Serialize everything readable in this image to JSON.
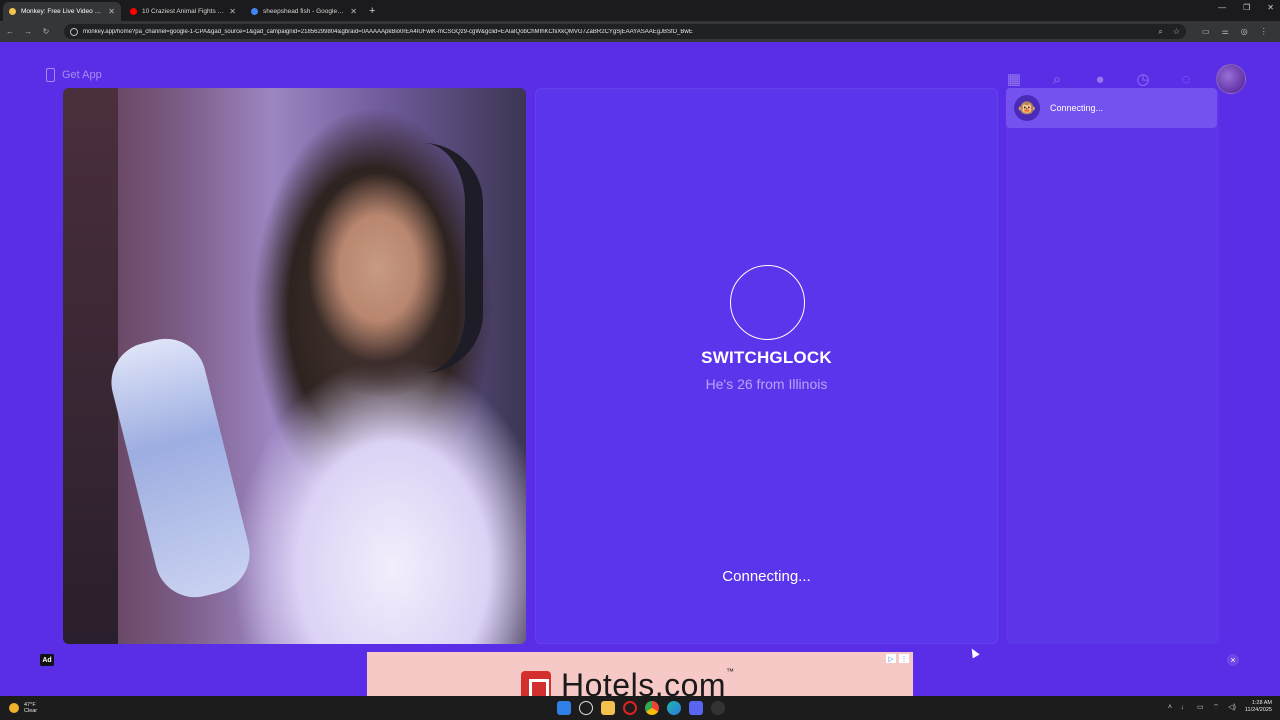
{
  "browser": {
    "tabs": [
      {
        "title": "Monkey: Free Live Video Chat",
        "active": true,
        "favicon_color": "#f5c24a"
      },
      {
        "title": "10 Craziest Animal Fights in the",
        "active": false,
        "favicon_color": "#ff0000"
      },
      {
        "title": "sheepshead fish - Google Search",
        "active": false,
        "favicon_color": "#4285f4"
      }
    ],
    "new_tab": "+",
    "url": "monkey.app/home?pa_channel=google-1-CPA&gad_source=1&gad_campaignid=21856299804&gbraid=0AAAAApkBio0rEA4IUFwiK-mCSGQz9-cgW&gclid=EAIaIQobChMIhKCfiiXkQMVG7ZaBR2CYgSjEAAYASAAEgJBSfD_BwE"
  },
  "page": {
    "get_app_label": "Get App",
    "match": {
      "name": "SWITCHGLOCK",
      "subtitle": "He's 26 from Illinois",
      "status": "Connecting..."
    },
    "side": {
      "chat_status": "Connecting...",
      "chat_avatar": "🐵"
    },
    "ad": {
      "badge": "Ad",
      "brand": "Hotels.com",
      "close": "×"
    }
  },
  "taskbar": {
    "temp": "47°F",
    "condition": "Clear",
    "time": "1:28 AM",
    "date": "11/24/2025"
  },
  "colors": {
    "page_bg": "#5a2ee6",
    "panel_bg": "#5b35ec",
    "chat_row": "#7352ef",
    "banner_bg": "#f7c9c6",
    "hotels_red": "#d32f2f"
  }
}
